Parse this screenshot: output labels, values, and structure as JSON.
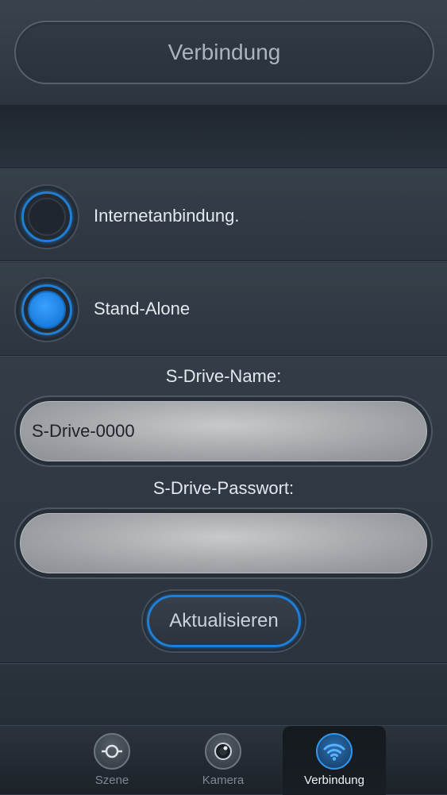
{
  "header": {
    "title": "Verbindung"
  },
  "connection_options": [
    {
      "label": "Internetanbindung.",
      "selected": false
    },
    {
      "label": "Stand-Alone",
      "selected": true
    }
  ],
  "form": {
    "name_label": "S-Drive-Name:",
    "name_value": "S-Drive-0000",
    "password_label": "S-Drive-Passwort:",
    "password_value": "",
    "update_button": "Aktualisieren"
  },
  "tabs": [
    {
      "label": "Szene",
      "icon": "scene-icon",
      "active": false
    },
    {
      "label": "Kamera",
      "icon": "camera-icon",
      "active": false
    },
    {
      "label": "Verbindung",
      "icon": "wifi-icon",
      "active": true
    }
  ],
  "colors": {
    "accent": "#1f7fd6",
    "background": "#2f3945"
  }
}
